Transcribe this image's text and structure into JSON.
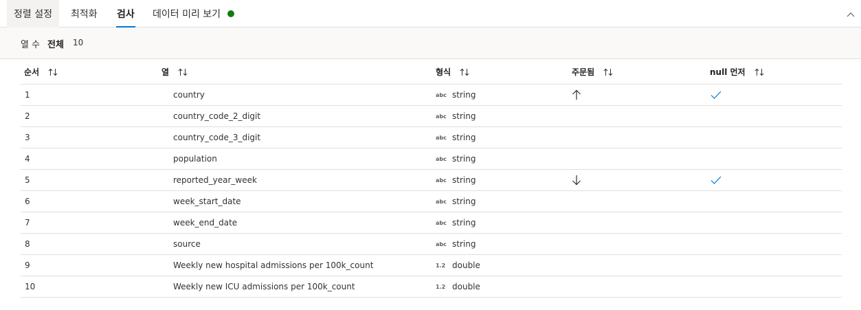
{
  "tabs": [
    {
      "label": "정렬 설정"
    },
    {
      "label": "최적화"
    },
    {
      "label": "검사"
    },
    {
      "label": "데이터 미리 보기"
    }
  ],
  "status_color": "#107c10",
  "accent_color": "#0078d4",
  "summary": {
    "label": "열 수",
    "label_bold": "전체",
    "value": "10"
  },
  "table": {
    "headers": {
      "order": "순서",
      "column": "열",
      "type": "형식",
      "sorted": "주문됨",
      "nulls_first": "null 먼저"
    },
    "rows": [
      {
        "order": "1",
        "column": "country",
        "type_icon": "abc",
        "type": "string",
        "sorted": "ascending",
        "nulls_first": true
      },
      {
        "order": "2",
        "column": "country_code_2_digit",
        "type_icon": "abc",
        "type": "string",
        "sorted": "",
        "nulls_first": false
      },
      {
        "order": "3",
        "column": "country_code_3_digit",
        "type_icon": "abc",
        "type": "string",
        "sorted": "",
        "nulls_first": false
      },
      {
        "order": "4",
        "column": "population",
        "type_icon": "abc",
        "type": "string",
        "sorted": "",
        "nulls_first": false
      },
      {
        "order": "5",
        "column": "reported_year_week",
        "type_icon": "abc",
        "type": "string",
        "sorted": "descending",
        "nulls_first": true
      },
      {
        "order": "6",
        "column": "week_start_date",
        "type_icon": "abc",
        "type": "string",
        "sorted": "",
        "nulls_first": false
      },
      {
        "order": "7",
        "column": "week_end_date",
        "type_icon": "abc",
        "type": "string",
        "sorted": "",
        "nulls_first": false
      },
      {
        "order": "8",
        "column": "source",
        "type_icon": "abc",
        "type": "string",
        "sorted": "",
        "nulls_first": false
      },
      {
        "order": "9",
        "column": "Weekly new hospital admissions per 100k_count",
        "type_icon": "1.2",
        "type": "double",
        "sorted": "",
        "nulls_first": false
      },
      {
        "order": "10",
        "column": "Weekly new ICU admissions per 100k_count",
        "type_icon": "1.2",
        "type": "double",
        "sorted": "",
        "nulls_first": false
      }
    ]
  }
}
